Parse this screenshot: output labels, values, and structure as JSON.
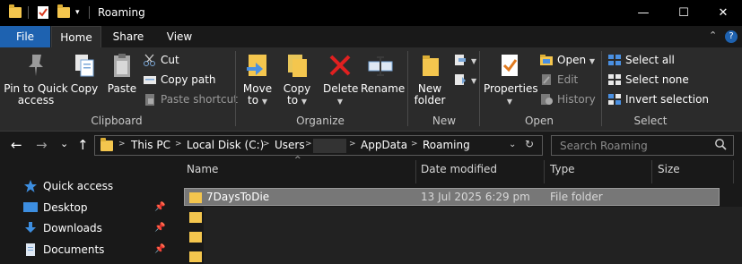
{
  "window": {
    "title": "Roaming",
    "minimize": "—",
    "maximize": "☐",
    "close": "✕"
  },
  "tabs": {
    "file": "File",
    "home": "Home",
    "share": "Share",
    "view": "View",
    "expand": "⌃",
    "help": "?"
  },
  "ribbon": {
    "clipboard": {
      "label": "Clipboard",
      "pin_line1": "Pin to Quick",
      "pin_line2": "access",
      "copy": "Copy",
      "paste": "Paste",
      "cut": "Cut",
      "copy_path": "Copy path",
      "paste_shortcut": "Paste shortcut"
    },
    "organize": {
      "label": "Organize",
      "move_line1": "Move",
      "move_line2": "to",
      "copy_line1": "Copy",
      "copy_line2": "to",
      "delete": "Delete",
      "rename": "Rename"
    },
    "new": {
      "label": "New",
      "new_folder_line1": "New",
      "new_folder_line2": "folder"
    },
    "open": {
      "label": "Open",
      "properties": "Properties",
      "open": "Open",
      "edit": "Edit",
      "history": "History"
    },
    "select": {
      "label": "Select",
      "select_all": "Select all",
      "select_none": "Select none",
      "invert": "Invert selection"
    }
  },
  "address": {
    "back": "←",
    "forward": "→",
    "recent": "⌄",
    "up": "↑",
    "crumbs": [
      "This PC",
      "Local Disk (C:)",
      "Users",
      "AppData",
      "Roaming"
    ],
    "search_placeholder": "Search Roaming"
  },
  "nav_pane": {
    "items": [
      {
        "label": "Quick access",
        "icon": "star-icon"
      },
      {
        "label": "Desktop",
        "icon": "desktop-icon"
      },
      {
        "label": "Downloads",
        "icon": "download-icon"
      },
      {
        "label": "Documents",
        "icon": "documents-icon"
      }
    ]
  },
  "file_list": {
    "columns": [
      "Name",
      "Date modified",
      "Type",
      "Size"
    ],
    "rows": [
      {
        "name": "7DaysToDie",
        "date": "13 Jul 2025 6:29 pm",
        "type": "File folder",
        "size": ""
      }
    ]
  },
  "colors": {
    "accent": "#1e62b0",
    "folder": "#f4c64e",
    "background": "#191919",
    "ribbon": "#2b2b2b"
  }
}
